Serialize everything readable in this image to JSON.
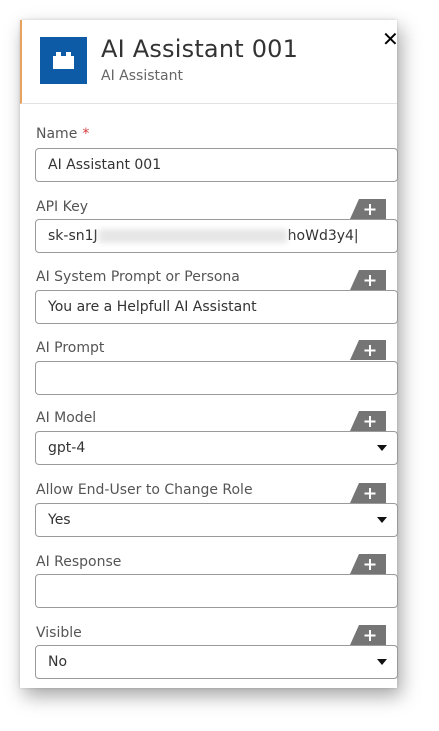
{
  "header": {
    "title": "AI Assistant 001",
    "subtitle": "AI Assistant",
    "close_glyph": "✕",
    "accent_color": "#e9a25d",
    "icon_bg": "#0d5aa6",
    "icon": "block-icon"
  },
  "fields": {
    "name": {
      "label": "Name",
      "required_mark": "*",
      "value": "AI Assistant 001"
    },
    "api_key": {
      "label": "API Key",
      "value_prefix": "sk-sn1J",
      "value_suffix": "hoWd3y4|"
    },
    "system_prompt": {
      "label": "AI System Prompt or Persona",
      "value": "You are a Helpfull AI Assistant"
    },
    "ai_prompt": {
      "label": "AI Prompt",
      "value": ""
    },
    "ai_model": {
      "label": "AI Model",
      "value": "gpt-4"
    },
    "allow_change_role": {
      "label": "Allow End-User to Change Role",
      "value": "Yes"
    },
    "ai_response": {
      "label": "AI Response",
      "value": ""
    },
    "visible": {
      "label": "Visible",
      "value": "No"
    }
  },
  "add_glyph": "+",
  "add_tab_color": "#757575"
}
